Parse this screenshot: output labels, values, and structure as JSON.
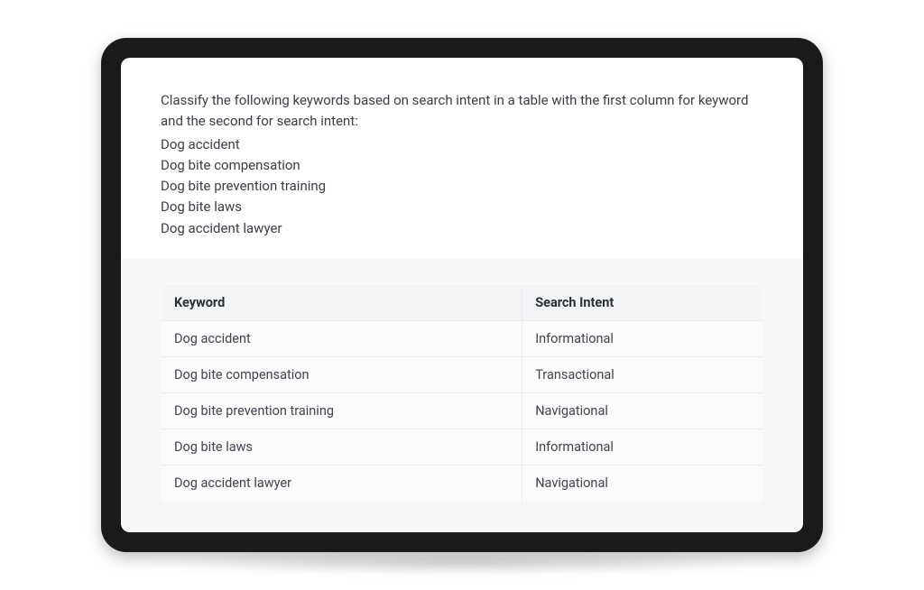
{
  "prompt": {
    "instruction": "Classify the following keywords based on search intent in a table with the first column for keyword and the second for search intent:",
    "keywords": [
      "Dog accident",
      "Dog bite compensation",
      "Dog bite prevention training",
      "Dog bite laws",
      "Dog accident lawyer"
    ]
  },
  "response": {
    "headers": {
      "col1": "Keyword",
      "col2": "Search Intent"
    },
    "rows": [
      {
        "keyword": "Dog accident",
        "intent": "Informational"
      },
      {
        "keyword": "Dog bite compensation",
        "intent": "Transactional"
      },
      {
        "keyword": "Dog bite prevention training",
        "intent": "Navigational"
      },
      {
        "keyword": "Dog bite laws",
        "intent": "Informational"
      },
      {
        "keyword": "Dog accident lawyer",
        "intent": "Navigational"
      }
    ]
  }
}
